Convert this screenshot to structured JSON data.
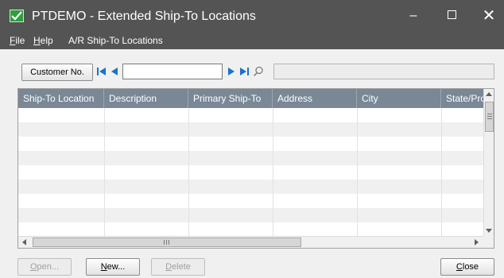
{
  "window": {
    "title": "PTDEMO - Extended Ship-To Locations",
    "icon": "app-window-icon",
    "minimize_label": "–",
    "close_label": "✕"
  },
  "menu": {
    "items": [
      {
        "mnemonic": "F",
        "rest": "ile"
      },
      {
        "mnemonic": "H",
        "rest": "elp"
      },
      {
        "label": "A/R Ship-To Locations"
      }
    ]
  },
  "toolbar": {
    "customer_button_label": "Customer No.",
    "customer_value": "",
    "customer_description": ""
  },
  "grid": {
    "columns": [
      "Ship-To Location",
      "Description",
      "Primary Ship-To",
      "Address",
      "City",
      "State/Pro"
    ],
    "rows": 9
  },
  "footer": {
    "open": {
      "mnemonic": "O",
      "rest": "pen...",
      "enabled": false
    },
    "new": {
      "mnemonic": "N",
      "rest": "ew...",
      "enabled": true
    },
    "delete": {
      "mnemonic": "D",
      "rest": "elete",
      "enabled": false
    },
    "close": {
      "mnemonic": "C",
      "rest": "lose",
      "enabled": true
    }
  },
  "colors": {
    "titlebar": "#545454",
    "grid_header": "#7a8896",
    "nav_arrow": "#1a73c9"
  }
}
